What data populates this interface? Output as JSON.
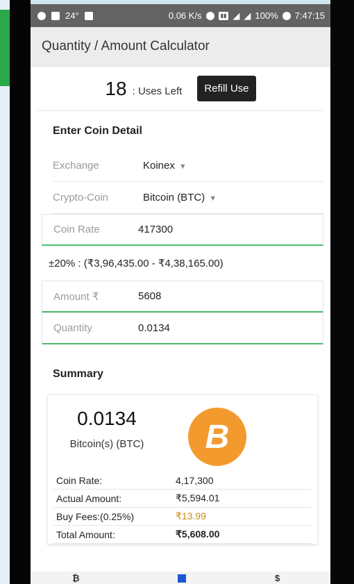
{
  "statusbar": {
    "temperature": "24°",
    "net_speed": "0.06 K/s",
    "battery": "100%",
    "time": "7:47:15"
  },
  "app": {
    "title": "Quantity / Amount Calculator"
  },
  "uses": {
    "count": "18",
    "label": ": Uses Left",
    "refill_label": "Refill Use"
  },
  "coin_detail": {
    "title": "Enter Coin Detail",
    "exchange_label": "Exchange",
    "exchange_value": "Koinex",
    "coin_label": "Crypto-Coin",
    "coin_value": "Bitcoin (BTC)",
    "rate_label": "Coin Rate",
    "rate_value": "417300",
    "range_text": "±20% : (₹3,96,435.00 - ₹4,38,165.00)",
    "amount_label": "Amount ₹",
    "amount_value": "5608",
    "quantity_label": "Quantity",
    "quantity_value": "0.0134"
  },
  "summary": {
    "title": "Summary",
    "quantity": "0.0134",
    "unit": "Bitcoin(s) (BTC)",
    "coin_symbol": "B",
    "rows": [
      {
        "key": "Coin Rate:",
        "value": "4,17,300"
      },
      {
        "key": "Actual Amount:",
        "value": "₹5,594.01"
      },
      {
        "key": "Buy Fees:(0.25%)",
        "value": "₹13.99"
      },
      {
        "key": "Total Amount:",
        "value": "₹5,608.00"
      }
    ]
  },
  "bottom_nav": {
    "left_icon": "bitcoin-icon",
    "center_icon": "calculator-icon",
    "right_icon": "dollar-icon"
  },
  "colors": {
    "accent_green": "#4dbb6e",
    "bitcoin_orange": "#f39a2f",
    "fee_color": "#c88a1c"
  }
}
